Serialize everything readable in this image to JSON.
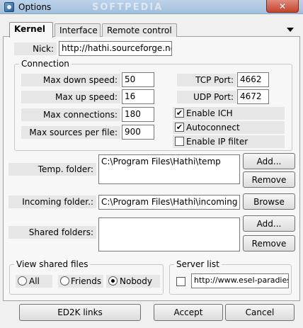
{
  "window": {
    "title": "Options",
    "watermark": "SOFTPEDIA",
    "close_glyph": "✕"
  },
  "tabs": [
    {
      "label": "Kernel"
    },
    {
      "label": "Interface"
    },
    {
      "label": "Remote control"
    }
  ],
  "kernel": {
    "nick_label": "Nick:",
    "nick_value": "http://hathi.sourceforge.net",
    "connection_group": "Connection",
    "max_down_label": "Max down speed:",
    "max_down_value": "50",
    "max_up_label": "Max up speed:",
    "max_up_value": "16",
    "max_conn_label": "Max connections:",
    "max_conn_value": "180",
    "max_sources_label": "Max sources per file:",
    "max_sources_value": "900",
    "tcp_label": "TCP Port:",
    "tcp_value": "4662",
    "udp_label": "UDP Port:",
    "udp_value": "4672",
    "enable_ich": "Enable ICH",
    "autoconnect": "Autoconnect",
    "enable_ip_filter": "Enable IP filter",
    "temp_label": "Temp. folder:",
    "temp_value": "C:\\Program Files\\Hathi\\temp",
    "incoming_label": "Incoming folder.:",
    "incoming_value": "C:\\Program Files\\Hathi\\incoming",
    "shared_label": "Shared folders:",
    "add_label": "Add...",
    "remove_label": "Remove",
    "browse_label": "Browse",
    "view_shared_group": "View shared files",
    "radio_all": "All",
    "radio_friends": "Friends",
    "radio_nobody": "Nobody",
    "server_list_group": "Server list",
    "server_list_value": "http://www.esel-paradies.de"
  },
  "footer": {
    "ed2k_label": "ED2K links",
    "accept_label": "Accept",
    "cancel_label": "Cancel"
  },
  "checks": {
    "enable_ich": true,
    "autoconnect": true,
    "enable_ip_filter": false,
    "server_list": false
  },
  "view_shared_selected": "Nobody"
}
